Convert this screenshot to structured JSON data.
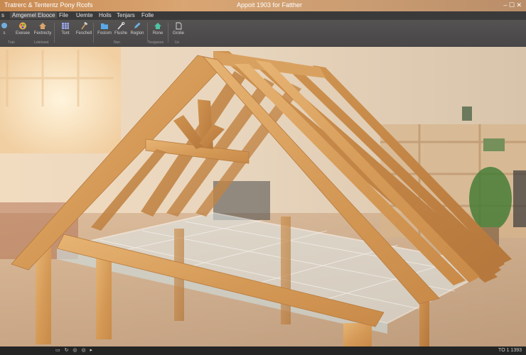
{
  "title_bar": {
    "app_title": "Tratrerc & Tententz Pony Rcofs",
    "doc_title": "Appoit 1903 for Fatther"
  },
  "menu": {
    "items": [
      "s",
      "Amgemel Elooce",
      "File",
      "Uemte",
      "Hoils",
      "Tenjars",
      "Folle"
    ]
  },
  "ribbon": {
    "buttons": [
      {
        "label": "s",
        "icon": "pin-icon"
      },
      {
        "label": "Exesee",
        "icon": "color-palette-icon"
      },
      {
        "label": "Fextrecty",
        "icon": "home-truss-icon"
      },
      {
        "label": "Tont",
        "icon": "grid-table-icon"
      },
      {
        "label": "Feschell",
        "icon": "hammer-icon"
      },
      {
        "label": "Foslom",
        "icon": "folder-icon"
      },
      {
        "label": "Flushe",
        "icon": "tools-icon"
      },
      {
        "label": "Reglon",
        "icon": "edit-icon"
      },
      {
        "label": "Rone",
        "icon": "house-icon"
      },
      {
        "label": "Grolie",
        "icon": "document-icon"
      }
    ],
    "group_labels": [
      "Tuto",
      "Lnletooet",
      "Nsn",
      "Tesigsees",
      "Uv"
    ]
  },
  "status_bar": {
    "left_icons": [
      "window-icon",
      "refresh-icon",
      "circle-icon",
      "circle-icon",
      "play-icon"
    ],
    "right_text": "TO 1 1393"
  },
  "colors": {
    "title_bar": "#c98a52",
    "menu_bar": "#3b3a3a",
    "ribbon": "#4f4d4c",
    "status_bar": "#242424",
    "wood": "#d8a260"
  }
}
